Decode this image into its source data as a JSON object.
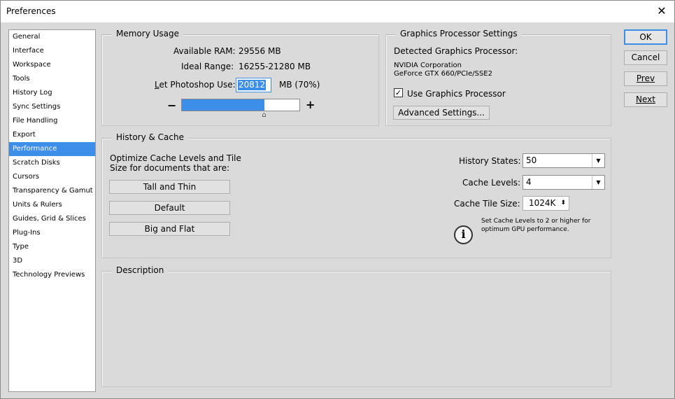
{
  "window": {
    "title": "Preferences"
  },
  "sidebar": {
    "items": [
      {
        "label": "General"
      },
      {
        "label": "Interface"
      },
      {
        "label": "Workspace"
      },
      {
        "label": "Tools"
      },
      {
        "label": "History Log"
      },
      {
        "label": "Sync Settings"
      },
      {
        "label": "File Handling"
      },
      {
        "label": "Export"
      },
      {
        "label": "Performance",
        "active": true
      },
      {
        "label": "Scratch Disks"
      },
      {
        "label": "Cursors"
      },
      {
        "label": "Transparency & Gamut"
      },
      {
        "label": "Units & Rulers"
      },
      {
        "label": "Guides, Grid & Slices"
      },
      {
        "label": "Plug-Ins"
      },
      {
        "label": "Type"
      },
      {
        "label": "3D"
      },
      {
        "label": "Technology Previews"
      }
    ]
  },
  "memory": {
    "title": "Memory Usage",
    "available_label": "Available RAM:",
    "available_value": "29556 MB",
    "ideal_label": "Ideal Range:",
    "ideal_value": "16255-21280 MB",
    "let_label": "Let Photoshop Use:",
    "let_value": "20812",
    "let_suffix": "MB (70%)",
    "minus": "−",
    "plus": "+",
    "slider_fraction": 0.7
  },
  "gpu": {
    "title": "Graphics Processor Settings",
    "detected_label": "Detected Graphics Processor:",
    "vendor": "NVIDIA Corporation",
    "model": "GeForce GTX 660/PCIe/SSE2",
    "use_label": "Use Graphics Processor",
    "use_checked": "✓",
    "advanced_button": "Advanced Settings..."
  },
  "history_cache": {
    "title": "History & Cache",
    "optimize_line1": "Optimize Cache Levels and Tile",
    "optimize_line2": "Size for documents that are:",
    "tall_thin": "Tall and Thin",
    "default": "Default",
    "big_flat": "Big and Flat",
    "history_states_label": "History States:",
    "history_states_value": "50",
    "cache_levels_label": "Cache Levels:",
    "cache_levels_value": "4",
    "tile_size_label": "Cache Tile Size:",
    "tile_size_value": "1024K",
    "info_line1": "Set Cache Levels to 2 or higher for",
    "info_line2": "optimum GPU performance."
  },
  "description": {
    "title": "Description"
  },
  "buttons": {
    "ok": "OK",
    "cancel": "Cancel",
    "prev": "Prev",
    "next": "Next"
  },
  "colors": {
    "accent": "#3d8ee8",
    "window_bg": "#dadada"
  }
}
